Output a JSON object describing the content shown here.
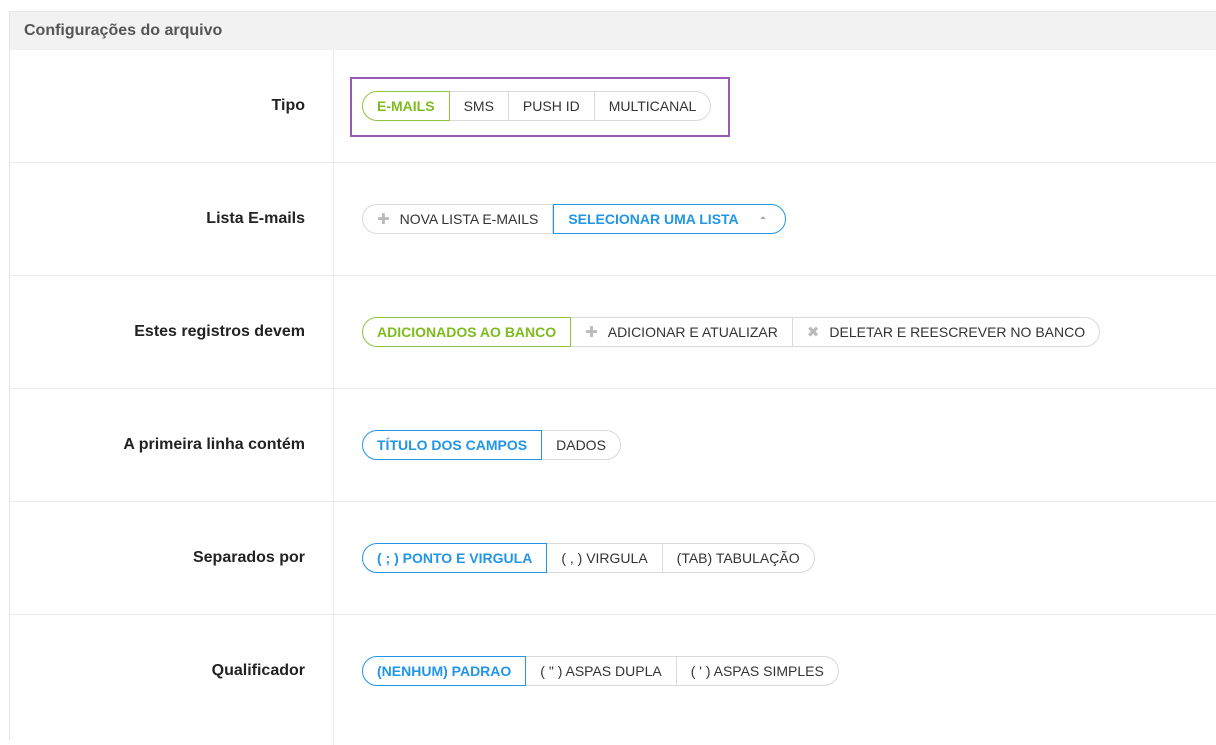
{
  "panel": {
    "title": "Configurações do arquivo"
  },
  "rows": [
    {
      "label": "Tipo",
      "buttons": [
        {
          "label": "E-MAILS",
          "state": "active"
        },
        {
          "label": "SMS"
        },
        {
          "label": "PUSH ID"
        },
        {
          "label": "MULTICANAL"
        }
      ]
    },
    {
      "label": "Lista E-mails",
      "buttons": [
        {
          "label": "NOVA LISTA E-MAILS",
          "icon": "plus-icon"
        },
        {
          "label": "SELECIONAR UMA LISTA",
          "state": "select",
          "icon": "caret-down-icon"
        }
      ]
    },
    {
      "label": "Estes registros devem",
      "buttons": [
        {
          "label": "ADICIONADOS AO BANCO",
          "state": "active"
        },
        {
          "label": "ADICIONAR E ATUALIZAR",
          "icon": "plus-icon"
        },
        {
          "label": "DELETAR E REESCREVER NO BANCO",
          "icon": "close-icon"
        }
      ]
    },
    {
      "label": "A primeira linha contém",
      "buttons": [
        {
          "label": "TÍTULO DOS CAMPOS",
          "state": "active"
        },
        {
          "label": "DADOS"
        }
      ]
    },
    {
      "label": "Separados por",
      "buttons": [
        {
          "label": "( ; ) PONTO E VIRGULA",
          "state": "active"
        },
        {
          "label": "( , ) VIRGULA"
        },
        {
          "label": "(TAB) TABULAÇÃO"
        }
      ]
    },
    {
      "label": "Qualificador",
      "buttons": [
        {
          "label": "(NENHUM) PADRAO",
          "state": "active"
        },
        {
          "label": "( \" ) ASPAS DUPLA"
        },
        {
          "label": "( ' ) ASPAS SIMPLES"
        }
      ]
    }
  ],
  "colors": {
    "active_green": "#8cc63f",
    "active_blue": "#2196e6",
    "highlight": "#9b59b6"
  }
}
